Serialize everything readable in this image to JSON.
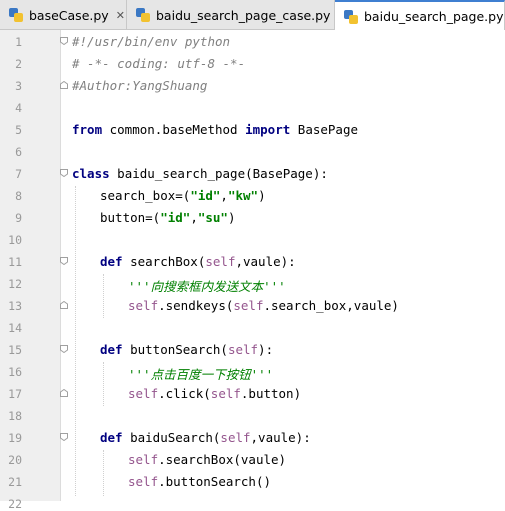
{
  "tabs": [
    {
      "label": "baseCase.py",
      "active": false
    },
    {
      "label": "baidu_search_page_case.py",
      "active": false
    },
    {
      "label": "baidu_search_page.py",
      "active": true
    }
  ],
  "line_numbers": [
    "1",
    "2",
    "3",
    "4",
    "5",
    "6",
    "7",
    "8",
    "9",
    "10",
    "11",
    "12",
    "13",
    "14",
    "15",
    "16",
    "17",
    "18",
    "19",
    "20",
    "21",
    "22"
  ],
  "code": {
    "l1": "#!/usr/bin/env python",
    "l2": "# -*- coding: utf-8 -*-",
    "l3": "#Author:YangShuang",
    "l5_kw1": "from",
    "l5_mod": " common.baseMethod ",
    "l5_kw2": "import",
    "l5_cls": " BasePage",
    "l7_kw": "class",
    "l7_rest": " baidu_search_page(BasePage):",
    "l8_a": "search_box=(",
    "l8_s1": "\"id\"",
    "l8_c": ",",
    "l8_s2": "\"kw\"",
    "l8_e": ")",
    "l9_a": "button=(",
    "l9_s1": "\"id\"",
    "l9_c": ",",
    "l9_s2": "\"su\"",
    "l9_e": ")",
    "l11_kw": "def",
    "l11_name": " searchBox(",
    "l11_self": "self",
    "l11_rest": ",vaule):",
    "l12": "'''向搜索框内发送文本'''",
    "l13_self": "self",
    "l13_a": ".sendkeys(",
    "l13_self2": "self",
    "l13_b": ".search_box,vaule)",
    "l15_kw": "def",
    "l15_name": " buttonSearch(",
    "l15_self": "self",
    "l15_rest": "):",
    "l16": "'''点击百度一下按钮'''",
    "l17_self": "self",
    "l17_a": ".click(",
    "l17_self2": "self",
    "l17_b": ".button)",
    "l19_kw": "def",
    "l19_name": " baiduSearch(",
    "l19_self": "self",
    "l19_rest": ",vaule):",
    "l20_self": "self",
    "l20_a": ".searchBox(vaule)",
    "l21_self": "self",
    "l21_a": ".buttonSearch()"
  },
  "colors": {
    "keyword": "#000080",
    "string": "#008000",
    "comment": "#808080",
    "self": "#94558d",
    "gutter": "#efefef",
    "active_tab_accent": "#3f7fd1"
  },
  "icons": {
    "tab_file_icon": "python-file-icon",
    "tab_close_icon": "close-icon",
    "fold_marker": "fold-marker-icon"
  }
}
